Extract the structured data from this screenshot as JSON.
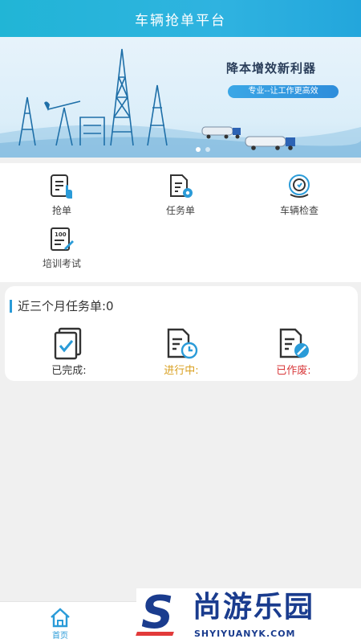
{
  "app": {
    "title": "车辆抢单平台"
  },
  "banner": {
    "slogan": "降本增效新利器",
    "tagline": "专业--让工作更高效",
    "slide_index": 1,
    "slide_count": 2
  },
  "menu": {
    "items": [
      {
        "label": "抢单",
        "icon": "grab-order-icon"
      },
      {
        "label": "任务单",
        "icon": "task-sheet-icon"
      },
      {
        "label": "车辆检查",
        "icon": "vehicle-inspect-icon"
      },
      {
        "label": "培训考试",
        "icon": "training-exam-icon"
      }
    ]
  },
  "stats": {
    "title": "近三个月任务单:0",
    "items": [
      {
        "label": "已完成:",
        "icon": "completed-icon",
        "color": "#333333"
      },
      {
        "label": "进行中:",
        "icon": "in-progress-icon",
        "color": "#d9a020"
      },
      {
        "label": "已作废:",
        "icon": "voided-icon",
        "color": "#d8383a"
      }
    ]
  },
  "tabbar": {
    "home_label": "首页"
  },
  "watermark": {
    "cn": "尚游乐园",
    "en": "SHYIYUANYK.COM",
    "letter": "S"
  },
  "colors": {
    "accent": "#2a9bd8",
    "title_bar": "#2fb3e0"
  }
}
